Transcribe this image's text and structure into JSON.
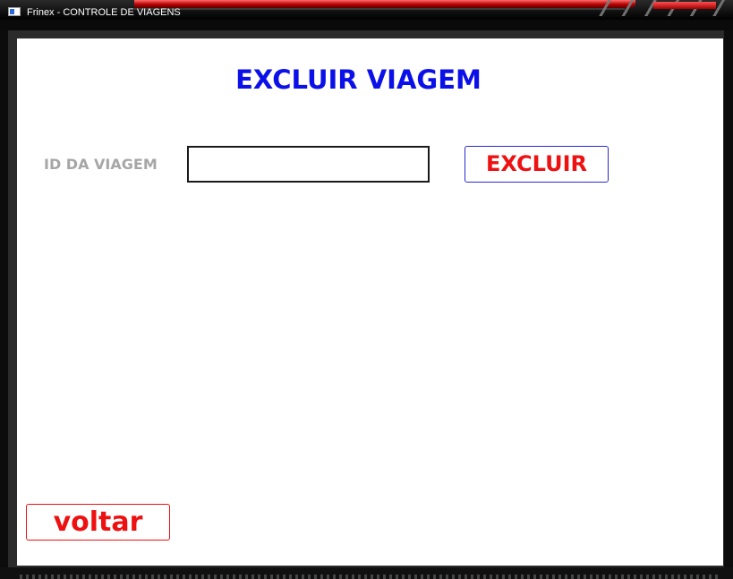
{
  "window": {
    "title": "Frinex - CONTROLE DE VIAGENS",
    "icon": "app-window-icon"
  },
  "page": {
    "title": "EXCLUIR VIAGEM"
  },
  "form": {
    "id_label": "ID DA VIAGEM",
    "id_value": "",
    "id_placeholder": ""
  },
  "buttons": {
    "excluir": "EXCLUIR",
    "voltar": "voltar"
  },
  "colors": {
    "title": "#0c10e8",
    "label": "#a6a6a6",
    "button_text": "#ee1111",
    "excluir_border": "#2a2ad0",
    "voltar_border": "#ee1111",
    "background": "#ffffff"
  }
}
